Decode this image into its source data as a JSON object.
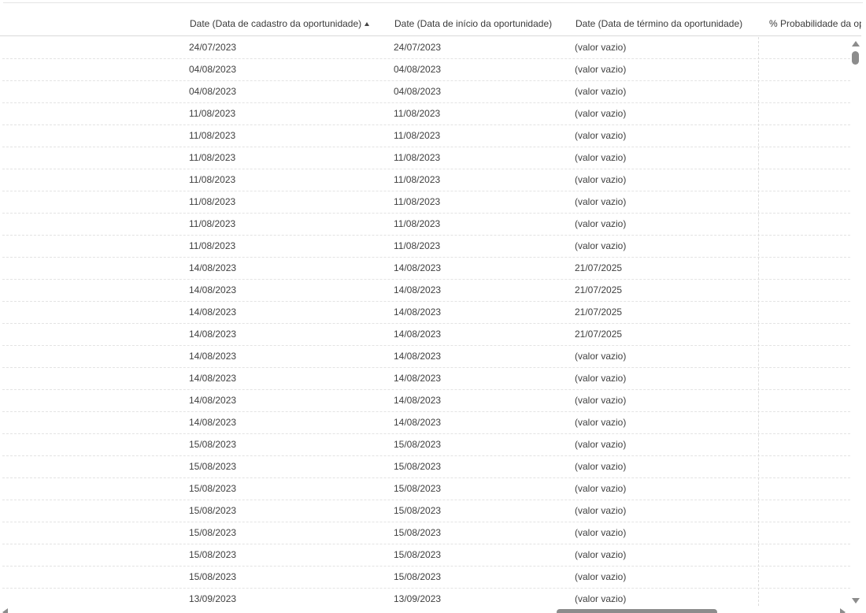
{
  "table": {
    "columns": [
      {
        "label": "Date (Data de cadastro da oportunidade)",
        "sorted": "ascending"
      },
      {
        "label": "Date (Data de início da oportunidade)"
      },
      {
        "label": "Date (Data de término da oportunidade)"
      },
      {
        "label": "% Probabilidade da op"
      }
    ],
    "rows": [
      [
        "24/07/2023",
        "24/07/2023",
        "(valor vazio)",
        ""
      ],
      [
        "04/08/2023",
        "04/08/2023",
        "(valor vazio)",
        ""
      ],
      [
        "04/08/2023",
        "04/08/2023",
        "(valor vazio)",
        ""
      ],
      [
        "11/08/2023",
        "11/08/2023",
        "(valor vazio)",
        ""
      ],
      [
        "11/08/2023",
        "11/08/2023",
        "(valor vazio)",
        ""
      ],
      [
        "11/08/2023",
        "11/08/2023",
        "(valor vazio)",
        ""
      ],
      [
        "11/08/2023",
        "11/08/2023",
        "(valor vazio)",
        ""
      ],
      [
        "11/08/2023",
        "11/08/2023",
        "(valor vazio)",
        ""
      ],
      [
        "11/08/2023",
        "11/08/2023",
        "(valor vazio)",
        ""
      ],
      [
        "11/08/2023",
        "11/08/2023",
        "(valor vazio)",
        ""
      ],
      [
        "14/08/2023",
        "14/08/2023",
        "21/07/2025",
        ""
      ],
      [
        "14/08/2023",
        "14/08/2023",
        "21/07/2025",
        ""
      ],
      [
        "14/08/2023",
        "14/08/2023",
        "21/07/2025",
        ""
      ],
      [
        "14/08/2023",
        "14/08/2023",
        "21/07/2025",
        ""
      ],
      [
        "14/08/2023",
        "14/08/2023",
        "(valor vazio)",
        ""
      ],
      [
        "14/08/2023",
        "14/08/2023",
        "(valor vazio)",
        ""
      ],
      [
        "14/08/2023",
        "14/08/2023",
        "(valor vazio)",
        ""
      ],
      [
        "14/08/2023",
        "14/08/2023",
        "(valor vazio)",
        ""
      ],
      [
        "15/08/2023",
        "15/08/2023",
        "(valor vazio)",
        ""
      ],
      [
        "15/08/2023",
        "15/08/2023",
        "(valor vazio)",
        ""
      ],
      [
        "15/08/2023",
        "15/08/2023",
        "(valor vazio)",
        ""
      ],
      [
        "15/08/2023",
        "15/08/2023",
        "(valor vazio)",
        ""
      ],
      [
        "15/08/2023",
        "15/08/2023",
        "(valor vazio)",
        ""
      ],
      [
        "15/08/2023",
        "15/08/2023",
        "(valor vazio)",
        ""
      ],
      [
        "15/08/2023",
        "15/08/2023",
        "(valor vazio)",
        ""
      ],
      [
        "13/09/2023",
        "13/09/2023",
        "(valor vazio)",
        ""
      ]
    ]
  },
  "icons": {
    "sort": "sort-ascending-icon",
    "scroll_up": "arrow-up-icon",
    "scroll_down": "arrow-down-icon",
    "scroll_left": "arrow-left-icon",
    "scroll_right": "arrow-right-icon"
  }
}
